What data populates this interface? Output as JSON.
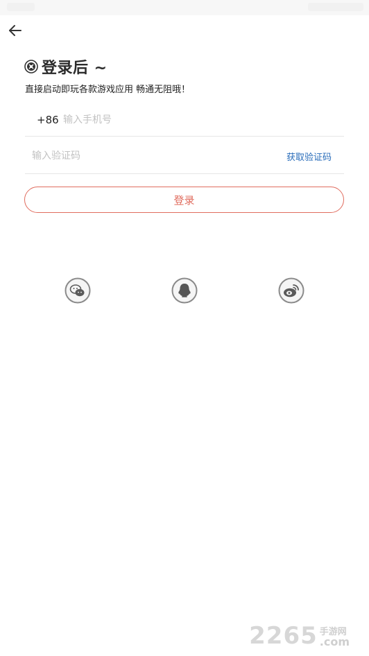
{
  "title": "登录后 ~",
  "subtitle": "直接启动即玩各款游戏应用 畅通无阻哦！",
  "phone": {
    "country_code": "+86",
    "placeholder": "输入手机号"
  },
  "verification": {
    "placeholder": "输入验证码",
    "get_code_label": "获取验证码"
  },
  "login_button_label": "登录",
  "social_logins": [
    "wechat-icon",
    "qq-icon",
    "weibo-icon"
  ],
  "watermark": {
    "digits": "2265",
    "cn": "手游网",
    "suffix": ".com"
  },
  "colors": {
    "accent": "#e06c5e",
    "link": "#2a6dba",
    "text": "#222222",
    "placeholder": "#c2c2c2",
    "divider": "#e6e6e6"
  }
}
